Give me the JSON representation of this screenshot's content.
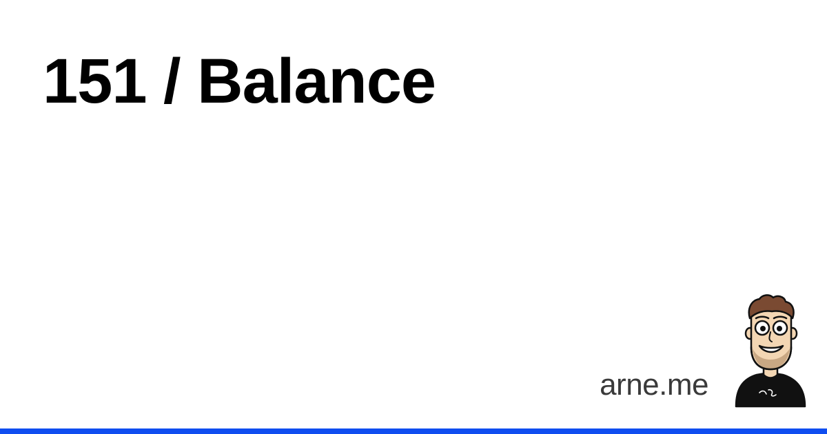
{
  "header": {
    "title": "151 / Balance"
  },
  "footer": {
    "site_name": "arne.me",
    "accent_color": "#0f4df0",
    "avatar_icon": "cartoon-portrait-avatar-icon"
  }
}
